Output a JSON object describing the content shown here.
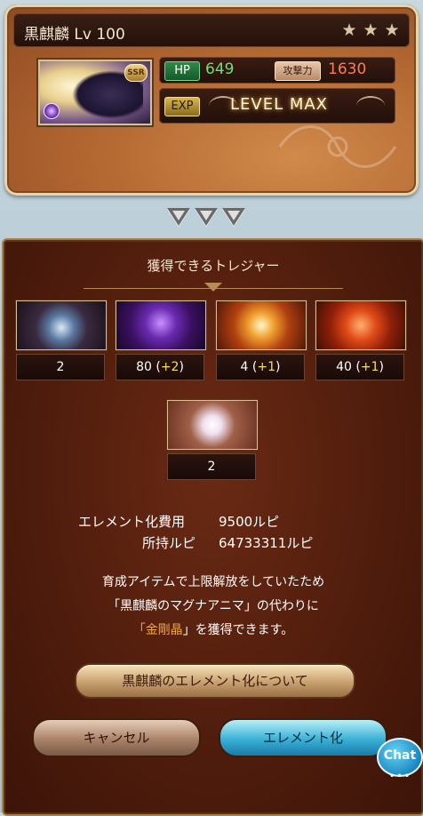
{
  "character": {
    "name": "黒麒麟",
    "level_label": "Lv 100",
    "star_count": 3,
    "rarity": "SSR",
    "hp_label": "HP",
    "hp_value": "649",
    "atk_label": "攻撃力",
    "atk_value": "1630",
    "exp_label": "EXP",
    "exp_status": "LEVEL MAX"
  },
  "panel": {
    "title": "獲得できるトレジャー",
    "treasures": [
      {
        "name": "orb",
        "count": "2",
        "bonus": ""
      },
      {
        "name": "dark-whorl",
        "count": "80",
        "bonus": "+2"
      },
      {
        "name": "crystal",
        "count": "4",
        "bonus": "+1"
      },
      {
        "name": "fire-quartz",
        "count": "40",
        "bonus": "+1"
      },
      {
        "name": "white-crystal",
        "count": "2",
        "bonus": ""
      }
    ],
    "cost_label": "エレメント化費用",
    "cost_value": "9500ルピ",
    "owned_label": "所持ルピ",
    "owned_value": "64733311ルピ",
    "message_line1": "育成アイテムで上限解放をしていたため",
    "message_line2": "「黒麒麟のマグナアニマ」の代わりに",
    "message_line3_open": "「",
    "message_line3_item": "金剛晶",
    "message_line3_rest": "」を獲得できます。",
    "about_button": "黒麒麟のエレメント化について",
    "cancel_button": "キャンセル",
    "confirm_button": "エレメント化",
    "chat_button": "Chat"
  },
  "colors": {
    "hp": "#6ee07a",
    "atk": "#ff7a5a",
    "highlight": "#f4a640",
    "bonus": "#f4e060"
  }
}
